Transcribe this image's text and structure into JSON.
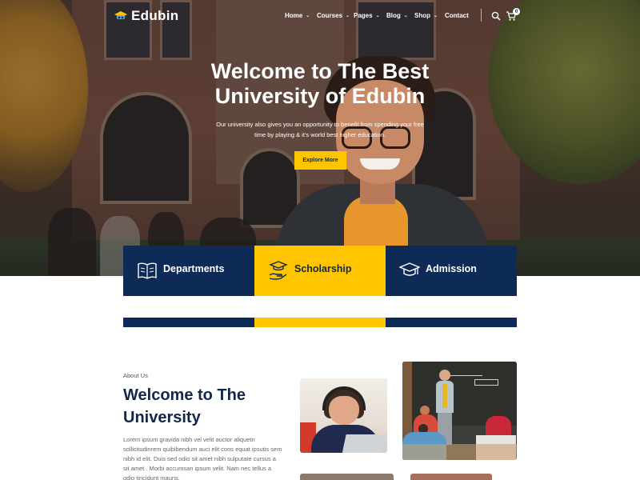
{
  "brand": {
    "name": "Edubin"
  },
  "nav": {
    "items": [
      {
        "label": "Home",
        "has_dropdown": true
      },
      {
        "label": "Courses",
        "has_dropdown": true
      },
      {
        "label": "Pages",
        "has_dropdown": true
      },
      {
        "label": "Blog",
        "has_dropdown": true
      },
      {
        "label": "Shop",
        "has_dropdown": true
      },
      {
        "label": "Contact",
        "has_dropdown": false
      }
    ],
    "dropdown_glyph": "⌄",
    "search_icon": "search-icon",
    "cart_icon": "cart-icon",
    "cart_count": "0"
  },
  "hero": {
    "title_line1": "Welcome to The Best",
    "title_line2": "University of Edubin",
    "subtitle_line1": "Our university also gives you an opportunity to benefit from spending your free",
    "subtitle_line2": "time by playing & it's world best higher education.",
    "cta_label": "Explore More"
  },
  "features": [
    {
      "label": "Departments",
      "icon": "book-icon"
    },
    {
      "label": "Scholarship",
      "icon": "scholarship-hand-icon"
    },
    {
      "label": "Admission",
      "icon": "graduation-cap-icon"
    }
  ],
  "about": {
    "tag": "About Us",
    "title_line1": "Welcome to The",
    "title_line2": "University",
    "body": "Lorem ipsum gravida nibh vel velit auctor aliquetn sollicitudinrem quibibendum auci elit cons equat ipsutis sem nibh id elit. Duis sed odio sit amet nibh sulputate cursus a sit amet . Morbi accumsan ipsum velit. Nam nec tellus a odio tincidunt mauris."
  },
  "colors": {
    "navy": "#0e2a56",
    "yellow": "#ffc600",
    "title_navy": "#11264a"
  }
}
